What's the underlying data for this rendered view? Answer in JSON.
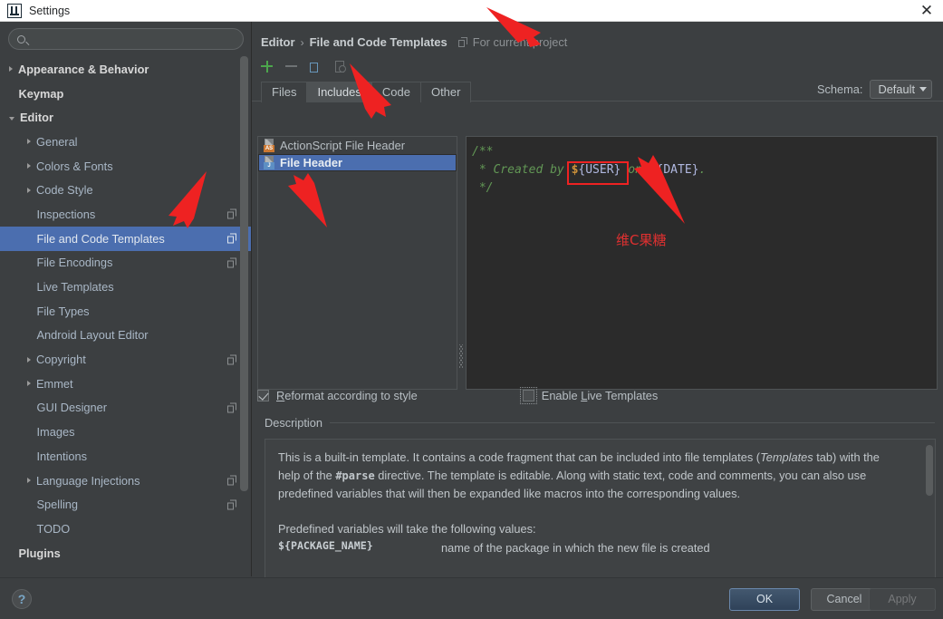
{
  "window": {
    "title": "Settings",
    "app_icon": "intellij-idea-icon",
    "close_label": "✕"
  },
  "sidebar": {
    "search": {
      "value": "",
      "placeholder": "",
      "icon": "search-icon"
    },
    "items": [
      {
        "label": "Appearance & Behavior",
        "indent": 0,
        "arrow": "closed",
        "bold": true,
        "badge": false,
        "selected": false
      },
      {
        "label": "Keymap",
        "indent": 0,
        "arrow": "none",
        "bold": true,
        "badge": false,
        "selected": false
      },
      {
        "label": "Editor",
        "indent": 0,
        "arrow": "open",
        "bold": true,
        "badge": false,
        "selected": false
      },
      {
        "label": "General",
        "indent": 1,
        "arrow": "closed",
        "bold": false,
        "badge": false,
        "selected": false
      },
      {
        "label": "Colors & Fonts",
        "indent": 1,
        "arrow": "closed",
        "bold": false,
        "badge": false,
        "selected": false
      },
      {
        "label": "Code Style",
        "indent": 1,
        "arrow": "closed",
        "bold": false,
        "badge": false,
        "selected": false
      },
      {
        "label": "Inspections",
        "indent": 1,
        "arrow": "none",
        "bold": false,
        "badge": true,
        "selected": false
      },
      {
        "label": "File and Code Templates",
        "indent": 1,
        "arrow": "none",
        "bold": false,
        "badge": true,
        "selected": true
      },
      {
        "label": "File Encodings",
        "indent": 1,
        "arrow": "none",
        "bold": false,
        "badge": true,
        "selected": false
      },
      {
        "label": "Live Templates",
        "indent": 1,
        "arrow": "none",
        "bold": false,
        "badge": false,
        "selected": false
      },
      {
        "label": "File Types",
        "indent": 1,
        "arrow": "none",
        "bold": false,
        "badge": false,
        "selected": false
      },
      {
        "label": "Android Layout Editor",
        "indent": 1,
        "arrow": "none",
        "bold": false,
        "badge": false,
        "selected": false
      },
      {
        "label": "Copyright",
        "indent": 1,
        "arrow": "closed",
        "bold": false,
        "badge": true,
        "selected": false
      },
      {
        "label": "Emmet",
        "indent": 1,
        "arrow": "closed",
        "bold": false,
        "badge": false,
        "selected": false
      },
      {
        "label": "GUI Designer",
        "indent": 1,
        "arrow": "none",
        "bold": false,
        "badge": true,
        "selected": false
      },
      {
        "label": "Images",
        "indent": 1,
        "arrow": "none",
        "bold": false,
        "badge": false,
        "selected": false
      },
      {
        "label": "Intentions",
        "indent": 1,
        "arrow": "none",
        "bold": false,
        "badge": false,
        "selected": false
      },
      {
        "label": "Language Injections",
        "indent": 1,
        "arrow": "closed",
        "bold": false,
        "badge": true,
        "selected": false
      },
      {
        "label": "Spelling",
        "indent": 1,
        "arrow": "none",
        "bold": false,
        "badge": true,
        "selected": false
      },
      {
        "label": "TODO",
        "indent": 1,
        "arrow": "none",
        "bold": false,
        "badge": false,
        "selected": false
      },
      {
        "label": "Plugins",
        "indent": 0,
        "arrow": "none",
        "bold": true,
        "badge": false,
        "selected": false
      }
    ]
  },
  "breadcrumb": {
    "parent": "Editor",
    "separator": "›",
    "current": "File and Code Templates",
    "project_scope": "For current project",
    "project_icon": "copy-scope-icon"
  },
  "schema": {
    "label": "Schema:",
    "value": "Default"
  },
  "toolbar": {
    "add": "add-icon",
    "remove": "remove-icon",
    "copy": "copy-icon",
    "reset": "reset-icon"
  },
  "tabs": [
    {
      "label": "Files",
      "active": false
    },
    {
      "label": "Includes",
      "active": true
    },
    {
      "label": "Code",
      "active": false
    },
    {
      "label": "Other",
      "active": false
    }
  ],
  "template_list": [
    {
      "label": "ActionScript File Header",
      "badge": "AS",
      "badge_color": "#cc7832",
      "selected": false
    },
    {
      "label": "File Header",
      "badge": "J",
      "badge_color": "#5d8fc4",
      "selected": true
    }
  ],
  "editor": {
    "lines": [
      {
        "segments": [
          {
            "text": "/**",
            "style": "comment"
          }
        ]
      },
      {
        "segments": [
          {
            "text": " * Created by ",
            "style": "comment"
          },
          {
            "text": "$",
            "style": "dollar"
          },
          {
            "text": "{USER}",
            "style": "var"
          },
          {
            "text": " on ",
            "style": "comment"
          },
          {
            "text": "$",
            "style": "dollar"
          },
          {
            "text": "{DATE}",
            "style": "var"
          },
          {
            "text": ".",
            "style": "comment"
          }
        ]
      },
      {
        "segments": [
          {
            "text": " */",
            "style": "comment"
          }
        ]
      }
    ]
  },
  "options": {
    "reformat": {
      "label_pre": "",
      "mnemonic": "R",
      "label_post": "eformat according to style",
      "checked": true
    },
    "live_templates": {
      "label_pre": "Enable ",
      "mnemonic": "L",
      "label_post": "ive Templates",
      "checked": false
    }
  },
  "description": {
    "title": "Description",
    "paragraph1_a": "This is a built-in template. It contains a code fragment that can be included into file templates (",
    "paragraph1_italic": "Templates",
    "paragraph1_b": " tab) with the help of the ",
    "paragraph1_code": "#parse",
    "paragraph1_c": " directive. The template is editable. Along with static text, code and comments, you can also use predefined variables that will then be expanded like macros into the corresponding values.",
    "paragraph2": "Predefined variables will take the following values:",
    "variables": [
      {
        "name": "${PACKAGE_NAME}",
        "meaning": "name of the package in which the new file is created"
      }
    ]
  },
  "footer": {
    "help": "?",
    "ok": "OK",
    "cancel": "Cancel",
    "apply": "Apply"
  },
  "annotations": {
    "note_text": "维C果糖",
    "color": "#e03030"
  }
}
